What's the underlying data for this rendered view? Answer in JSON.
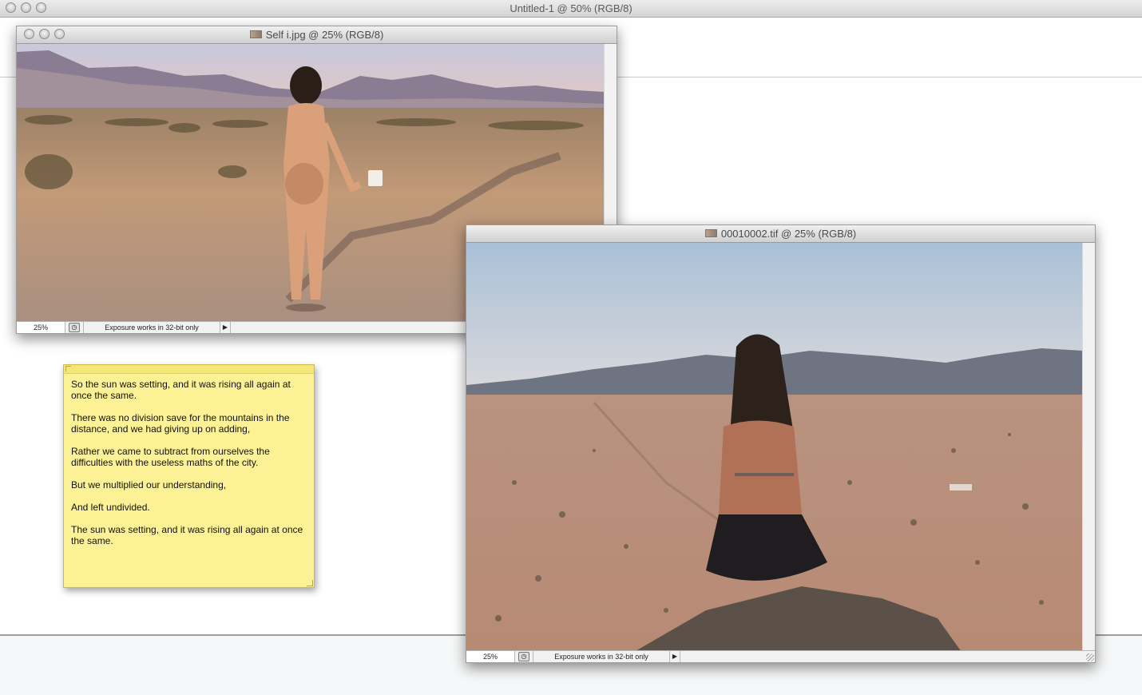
{
  "main_window": {
    "title": "Untitled-1 @ 50% (RGB/8)"
  },
  "doc1": {
    "title": "Self i.jpg @ 25% (RGB/8)",
    "zoom": "25%",
    "status": "Exposure works in 32-bit only"
  },
  "doc2": {
    "title": "00010002.tif @ 25% (RGB/8)",
    "zoom": "25%",
    "status": "Exposure works in 32-bit only"
  },
  "sticky_note": {
    "paragraphs": [
      "So the sun was setting, and it was rising all again at once the same.",
      "There was no division save for the mountains in the distance, and we had giving up on adding,",
      "Rather we came to subtract from ourselves the difficulties with the useless maths of the city.",
      "But we multiplied our understanding,",
      "And left undivided.",
      "The sun was setting, and it was rising all again at once the same."
    ]
  },
  "colors": {
    "sticky": "#fdf195",
    "sky": "#c9cfe0",
    "sand": "#b88a6a"
  }
}
